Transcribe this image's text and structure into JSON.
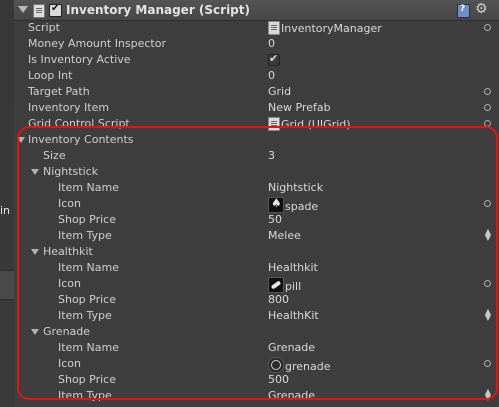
{
  "left_panel": {
    "cut_text": "in"
  },
  "component": {
    "title": "Inventory Manager (Script)",
    "enabled": true,
    "icon": "script-icon",
    "help_icon": "book-help-icon",
    "settings_icon": "gear-icon"
  },
  "fields": {
    "script": {
      "label": "Script",
      "value": "InventoryManager"
    },
    "money": {
      "label": "Money Amount Inspector",
      "value": "0"
    },
    "active": {
      "label": "Is Inventory Active",
      "checked": true
    },
    "loop": {
      "label": "Loop Int",
      "value": "0"
    },
    "target": {
      "label": "Target Path",
      "value": "Grid"
    },
    "item": {
      "label": "Inventory Item",
      "value": "New Prefab"
    },
    "grid_control": {
      "label": "Grid Control Script",
      "value": "Grid (UIGrid)"
    }
  },
  "contents": {
    "label": "Inventory Contents",
    "size_label": "Size",
    "size_value": "3",
    "items": [
      {
        "name": "Nightstick",
        "fields": {
          "name_label": "Item Name",
          "name_value": "Nightstick",
          "icon_label": "Icon",
          "icon_value": "spade",
          "price_label": "Shop Price",
          "price_value": "50",
          "type_label": "Item Type",
          "type_value": "Melee"
        }
      },
      {
        "name": "Healthkit",
        "fields": {
          "name_label": "Item Name",
          "name_value": "Healthkit",
          "icon_label": "Icon",
          "icon_value": "pill",
          "price_label": "Shop Price",
          "price_value": "800",
          "type_label": "Item Type",
          "type_value": "HealthKit"
        }
      },
      {
        "name": "Grenade",
        "fields": {
          "name_label": "Item Name",
          "name_value": "Grenade",
          "icon_label": "Icon",
          "icon_value": "grenade",
          "price_label": "Shop Price",
          "price_value": "500",
          "type_label": "Item Type",
          "type_value": "Grenade"
        }
      }
    ]
  },
  "colors": {
    "highlight": "#e01515",
    "panel": "#3e3e3e"
  }
}
